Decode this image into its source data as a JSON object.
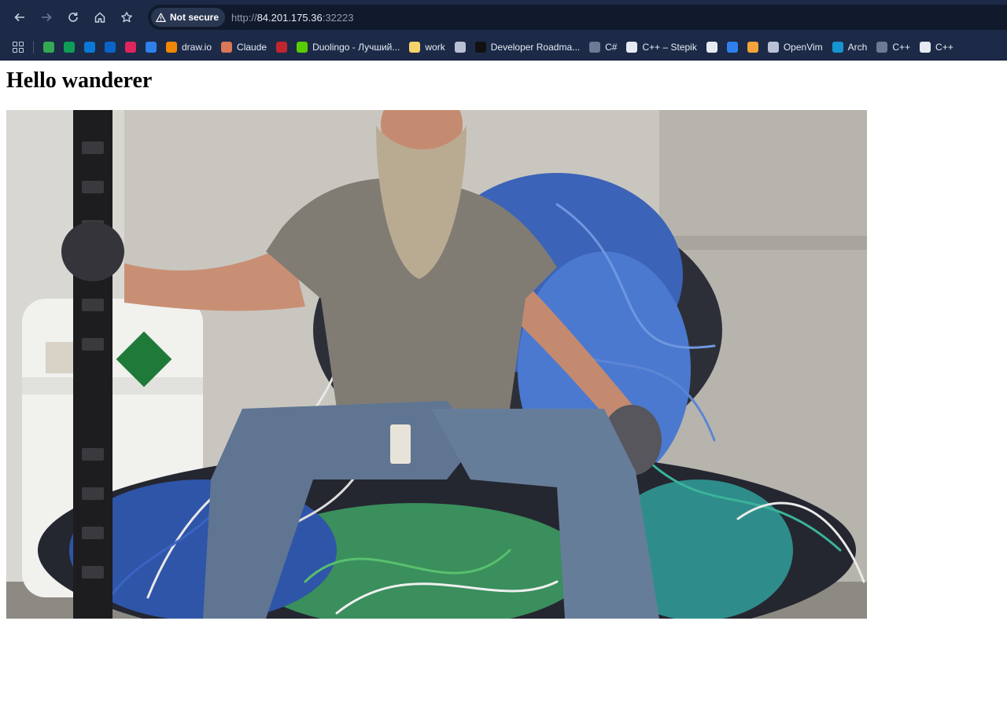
{
  "browser": {
    "security_label": "Not secure",
    "url_scheme": "http://",
    "url_host": "84.201.175.36",
    "url_port": ":32223",
    "bookmarks": [
      {
        "label": "",
        "icon": "google-drive-icon",
        "color": "#34a853"
      },
      {
        "label": "",
        "icon": "sheets-icon",
        "color": "#0f9d58"
      },
      {
        "label": "",
        "icon": "onedrive-icon",
        "color": "#0a78d4"
      },
      {
        "label": "",
        "icon": "outlook-icon",
        "color": "#0a64c8"
      },
      {
        "label": "",
        "icon": "hex-icon",
        "color": "#e0245e"
      },
      {
        "label": "",
        "icon": "vscode-icon",
        "color": "#2f80ed"
      },
      {
        "label": "draw.io",
        "icon": "drawio-icon",
        "color": "#f08705"
      },
      {
        "label": "Claude",
        "icon": "claude-icon",
        "color": "#d97757"
      },
      {
        "label": "",
        "icon": "red-mark-icon",
        "color": "#c0262d"
      },
      {
        "label": "Duolingo - Лучший...",
        "icon": "duolingo-icon",
        "color": "#58cc02"
      },
      {
        "label": "work",
        "icon": "folder-icon",
        "color": "#f6d36b"
      },
      {
        "label": "",
        "icon": "globe-icon",
        "color": "#b8c2d4"
      },
      {
        "label": "Developer Roadma...",
        "icon": "roadmap-icon",
        "color": "#111111"
      },
      {
        "label": "C#",
        "icon": "page-icon",
        "color": "#6b7a96"
      },
      {
        "label": "C++ – Stepik",
        "icon": "stepik-icon",
        "color": "#e6ebf3"
      },
      {
        "label": "",
        "icon": "mushroom-icon",
        "color": "#e6ebf3"
      },
      {
        "label": "",
        "icon": "x-tool-icon",
        "color": "#2f80ed"
      },
      {
        "label": "",
        "icon": "cat-icon",
        "color": "#f2a33a"
      },
      {
        "label": "OpenVim",
        "icon": "globe-icon",
        "color": "#b8c2d4"
      },
      {
        "label": "Arch",
        "icon": "arch-icon",
        "color": "#1793d1"
      },
      {
        "label": "C++",
        "icon": "page-icon",
        "color": "#6b7a96"
      },
      {
        "label": "C++",
        "icon": "cpp-icon",
        "color": "#e6ebf3"
      }
    ]
  },
  "page": {
    "heading": "Hello wanderer"
  }
}
